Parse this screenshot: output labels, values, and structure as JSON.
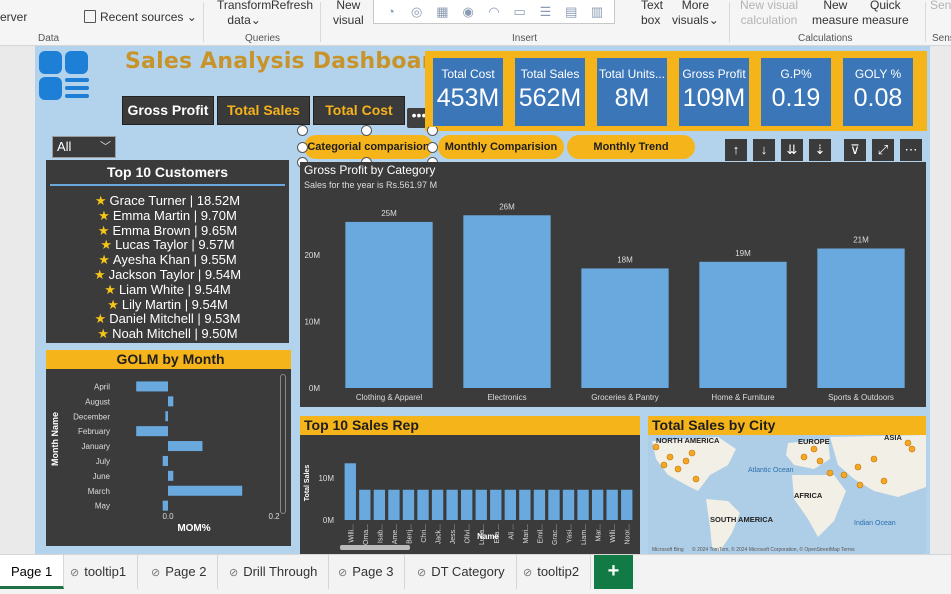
{
  "ribbon": {
    "server_label": "erver",
    "recent_sources": "Recent sources",
    "transform_data": "Transform",
    "transform_data_2": "data",
    "refresh": "Refresh",
    "new_visual": "New",
    "new_visual_2": "visual",
    "text_box": "Text",
    "text_box_2": "box",
    "more_visuals": "More",
    "more_visuals_2": "visuals",
    "new_visual_calc": "New visual",
    "new_visual_calc_2": "calculation",
    "new_measure": "New",
    "new_measure_2": "measure",
    "quick_measure": "Quick",
    "quick_measure_2": "measure",
    "sens": "Sens",
    "groups": {
      "data": "Data",
      "queries": "Queries",
      "insert": "Insert",
      "calculations": "Calculations",
      "sens": "Sens"
    }
  },
  "dashboard": {
    "title": "Sales Analysis Dashboard",
    "toggles": [
      "Gross Profit",
      "Total Sales",
      "Total Cost"
    ],
    "more_symbol": "•••",
    "kpis": [
      {
        "label": "Total Cost",
        "value": "453M"
      },
      {
        "label": "Total Sales",
        "value": "562M"
      },
      {
        "label": "Total Units...",
        "value": "8M"
      },
      {
        "label": "Gross Profit",
        "value": "109M"
      },
      {
        "label": "G.P%",
        "value": "0.19"
      },
      {
        "label": "GOLY %",
        "value": "0.08"
      }
    ],
    "filter_value": "All",
    "pills": [
      "Categorial comparision",
      "Monthly Comparision",
      "Monthly Trend"
    ]
  },
  "top_customers": {
    "title": "Top 10 Customers",
    "items": [
      "Grace Turner | 18.52M",
      "Emma Martin | 9.70M",
      "Emma Brown | 9.65M",
      "Lucas Taylor | 9.57M",
      "Ayesha Khan | 9.55M",
      "Jackson Taylor | 9.54M",
      "Liam White | 9.54M",
      "Lily Martin | 9.54M",
      "Daniel Mitchell | 9.53M",
      "Noah Mitchell | 9.50M"
    ]
  },
  "chart_data": [
    {
      "type": "bar",
      "title": "Gross Profit by Category",
      "subtitle": "Sales for the year is Rs.561.97 M",
      "categories": [
        "Clothing & Apparel",
        "Electronics",
        "Groceries & Pantry",
        "Home & Furniture",
        "Sports & Outdoors"
      ],
      "values": [
        25,
        26,
        18,
        19,
        21
      ],
      "data_labels": [
        "25M",
        "26M",
        "18M",
        "19M",
        "21M"
      ],
      "y_ticks": [
        "0M",
        "10M",
        "20M"
      ],
      "ylim": [
        0,
        28
      ],
      "unit": "M",
      "grid": false,
      "color": "#6aa9de"
    },
    {
      "type": "bar",
      "orientation": "horizontal",
      "title": "GOLM by Month",
      "categories": [
        "April",
        "August",
        "December",
        "February",
        "January",
        "July",
        "June",
        "March",
        "May"
      ],
      "values": [
        -0.06,
        0.01,
        -0.005,
        -0.06,
        0.065,
        -0.01,
        0.01,
        0.14,
        -0.01
      ],
      "xlabel": "MOM%",
      "ylabel": "Month Name",
      "x_ticks": [
        "0.0",
        "0.2"
      ],
      "xlim": [
        -0.1,
        0.2
      ],
      "color": "#6aa9de"
    },
    {
      "type": "bar",
      "title": "Top 10 Sales Rep",
      "categories": [
        "Willi...",
        "Oma...",
        "Isab...",
        "Ame...",
        "Benj...",
        "Chri...",
        "Jack...",
        "Jess...",
        "Olivi...",
        "Luca...",
        "Ella ...",
        "Ali ...",
        "Mari...",
        "Emil...",
        "Grac...",
        "Yasi...",
        "Liam...",
        "Mar...",
        "Willi...",
        "Noor..."
      ],
      "values": [
        13.5,
        7.2,
        7.2,
        7.2,
        7.2,
        7.2,
        7.2,
        7.2,
        7.2,
        7.2,
        7.2,
        7.2,
        7.2,
        7.2,
        7.2,
        7.2,
        7.2,
        7.2,
        7.2,
        7.2
      ],
      "xlabel": "Name",
      "ylabel": "Total Sales",
      "y_ticks": [
        "0M",
        "10M"
      ],
      "ylim": [
        0,
        15
      ],
      "color": "#6aa9de"
    }
  ],
  "map": {
    "title": "Total Sales by City",
    "labels": [
      "NORTH AMERICA",
      "EUROPE",
      "ASIA",
      "Atlantic Ocean",
      "AFRICA",
      "SOUTH AMERICA",
      "Indian Ocean"
    ],
    "attribution": "Microsoft Bing",
    "copyright": "© 2024 TomTom, © 2024 Microsoft Corporation, © OpenStreetMap  Terms"
  },
  "tabs": {
    "items": [
      "Page 1",
      "tooltip1",
      "Page 2",
      "Drill Through",
      "Page 3",
      "DT Category",
      "tooltip2"
    ],
    "add": "+"
  }
}
